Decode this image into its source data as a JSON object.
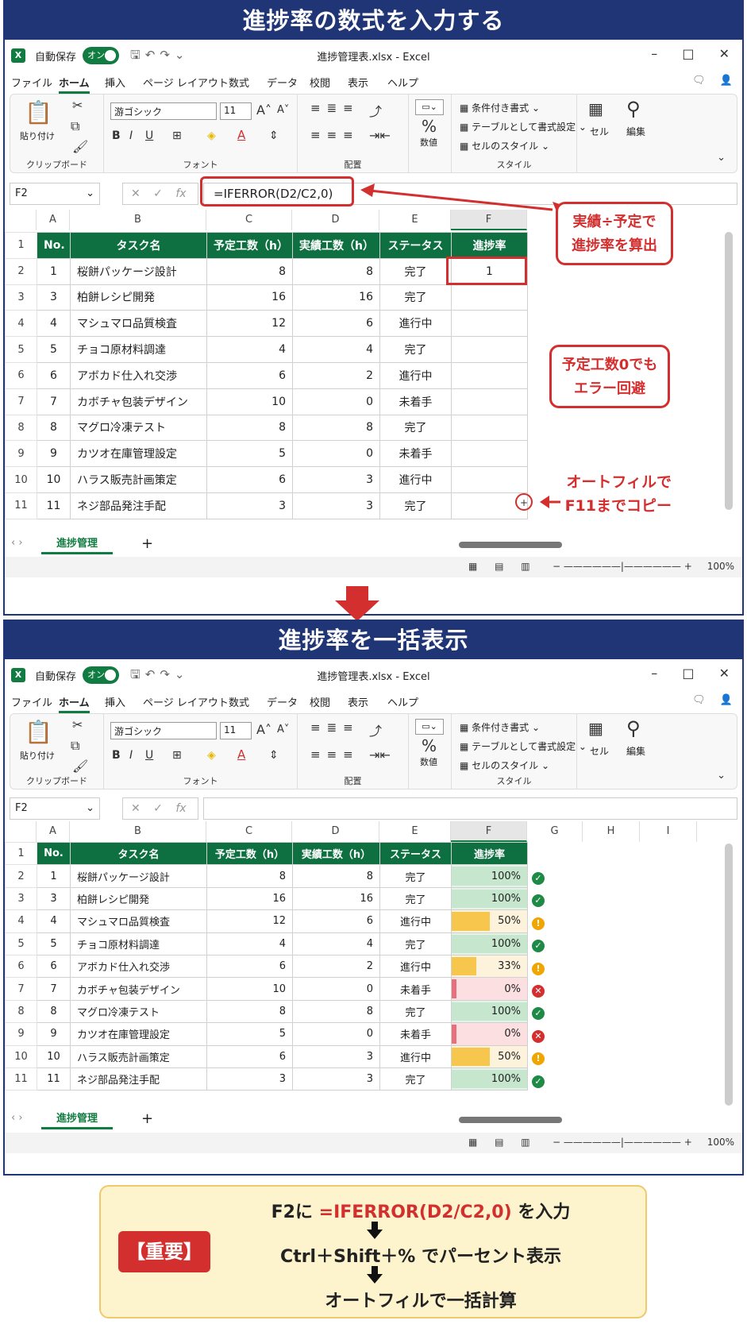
{
  "sections": {
    "top_title": "進捗率の数式を入力する",
    "bottom_title": "進捗率を一括表示"
  },
  "window": {
    "autosave_label": "自動保存",
    "autosave_state": "オン",
    "title": "進捗管理表.xlsx - Excel",
    "minimize": "–",
    "maximize": "□",
    "close": "✕"
  },
  "menu": [
    "ファイル",
    "ホーム",
    "挿入",
    "ページ レイアウト",
    "数式",
    "データ",
    "校閲",
    "表示",
    "ヘルプ"
  ],
  "ribbon": {
    "paste": "貼り付け",
    "clipboard": "クリップボード",
    "font_name": "游ゴシック",
    "font_size": "11",
    "font_group": "フォント",
    "alignment_group": "配置",
    "number_label": "数値",
    "number_symbol": "%",
    "cond_format": "条件付き書式",
    "table_format": "テーブルとして書式設定",
    "cell_styles": "セルのスタイル",
    "styles_group": "スタイル",
    "cells": "セル",
    "editing": "編集"
  },
  "formula_bar": {
    "name_box": "F2",
    "fx": "fx",
    "formula": "=IFERROR(D2/C2,0)"
  },
  "columns_top": [
    "A",
    "B",
    "C",
    "D",
    "E",
    "F"
  ],
  "columns_bottom": [
    "A",
    "B",
    "C",
    "D",
    "E",
    "F",
    "G",
    "H",
    "I"
  ],
  "headers": [
    "No.",
    "タスク名",
    "予定工数（h）",
    "実績工数（h）",
    "ステータス",
    "進捗率"
  ],
  "rows": [
    {
      "row": "2",
      "no": "1",
      "name": "桜餅パッケージ設計",
      "plan": "8",
      "actual": "8",
      "status": "完了",
      "pct": "100%",
      "val": 1.0,
      "icon": "check"
    },
    {
      "row": "3",
      "no": "3",
      "name": "柏餅レシピ開発",
      "plan": "16",
      "actual": "16",
      "status": "完了",
      "pct": "100%",
      "val": 1.0,
      "icon": "check"
    },
    {
      "row": "4",
      "no": "4",
      "name": "マシュマロ品質検査",
      "plan": "12",
      "actual": "6",
      "status": "進行中",
      "pct": "50%",
      "val": 0.5,
      "icon": "warn"
    },
    {
      "row": "5",
      "no": "5",
      "name": "チョコ原材料調達",
      "plan": "4",
      "actual": "4",
      "status": "完了",
      "pct": "100%",
      "val": 1.0,
      "icon": "check"
    },
    {
      "row": "6",
      "no": "6",
      "name": "アボカド仕入れ交渉",
      "plan": "6",
      "actual": "2",
      "status": "進行中",
      "pct": "33%",
      "val": 0.33,
      "icon": "warn"
    },
    {
      "row": "7",
      "no": "7",
      "name": "カボチャ包装デザイン",
      "plan": "10",
      "actual": "0",
      "status": "未着手",
      "pct": "0%",
      "val": 0,
      "icon": "cross"
    },
    {
      "row": "8",
      "no": "8",
      "name": "マグロ冷凍テスト",
      "plan": "8",
      "actual": "8",
      "status": "完了",
      "pct": "100%",
      "val": 1.0,
      "icon": "check"
    },
    {
      "row": "9",
      "no": "9",
      "name": "カツオ在庫管理設定",
      "plan": "5",
      "actual": "0",
      "status": "未着手",
      "pct": "0%",
      "val": 0,
      "icon": "cross"
    },
    {
      "row": "10",
      "no": "10",
      "name": "ハラス販売計画策定",
      "plan": "6",
      "actual": "3",
      "status": "進行中",
      "pct": "50%",
      "val": 0.5,
      "icon": "warn"
    },
    {
      "row": "11",
      "no": "11",
      "name": "ネジ部品発注手配",
      "plan": "3",
      "actual": "3",
      "status": "完了",
      "pct": "100%",
      "val": 1.0,
      "icon": "check"
    }
  ],
  "top_f2_value": "1",
  "row_header_1": "1",
  "sheet_tab": "進捗管理",
  "add_sheet": "+",
  "zoom": "100%",
  "callouts": {
    "c1_line1": "実績÷予定で",
    "c1_line2": "進捗率を算出",
    "c2_line1": "予定工数0でも",
    "c2_line2": "エラー回避",
    "c3_line1": "オートフィルで",
    "c3_line2": "F11までコピー"
  },
  "summary": {
    "badge": "【重要】",
    "line1_pre": "F2に ",
    "line1_formula": "=IFERROR(D2/C2,0)",
    "line1_post": " を入力",
    "line2": "Ctrl＋Shift＋% でパーセント表示",
    "line3": "オートフィルで一括計算"
  },
  "colors": {
    "header_green": "#0e7040",
    "banner_navy": "#1f3575",
    "accent_red": "#d32f2f",
    "bar_green": "#c6e7cd",
    "bar_yellow": "#f7c64c",
    "bar_red": "#f4b6bb"
  }
}
